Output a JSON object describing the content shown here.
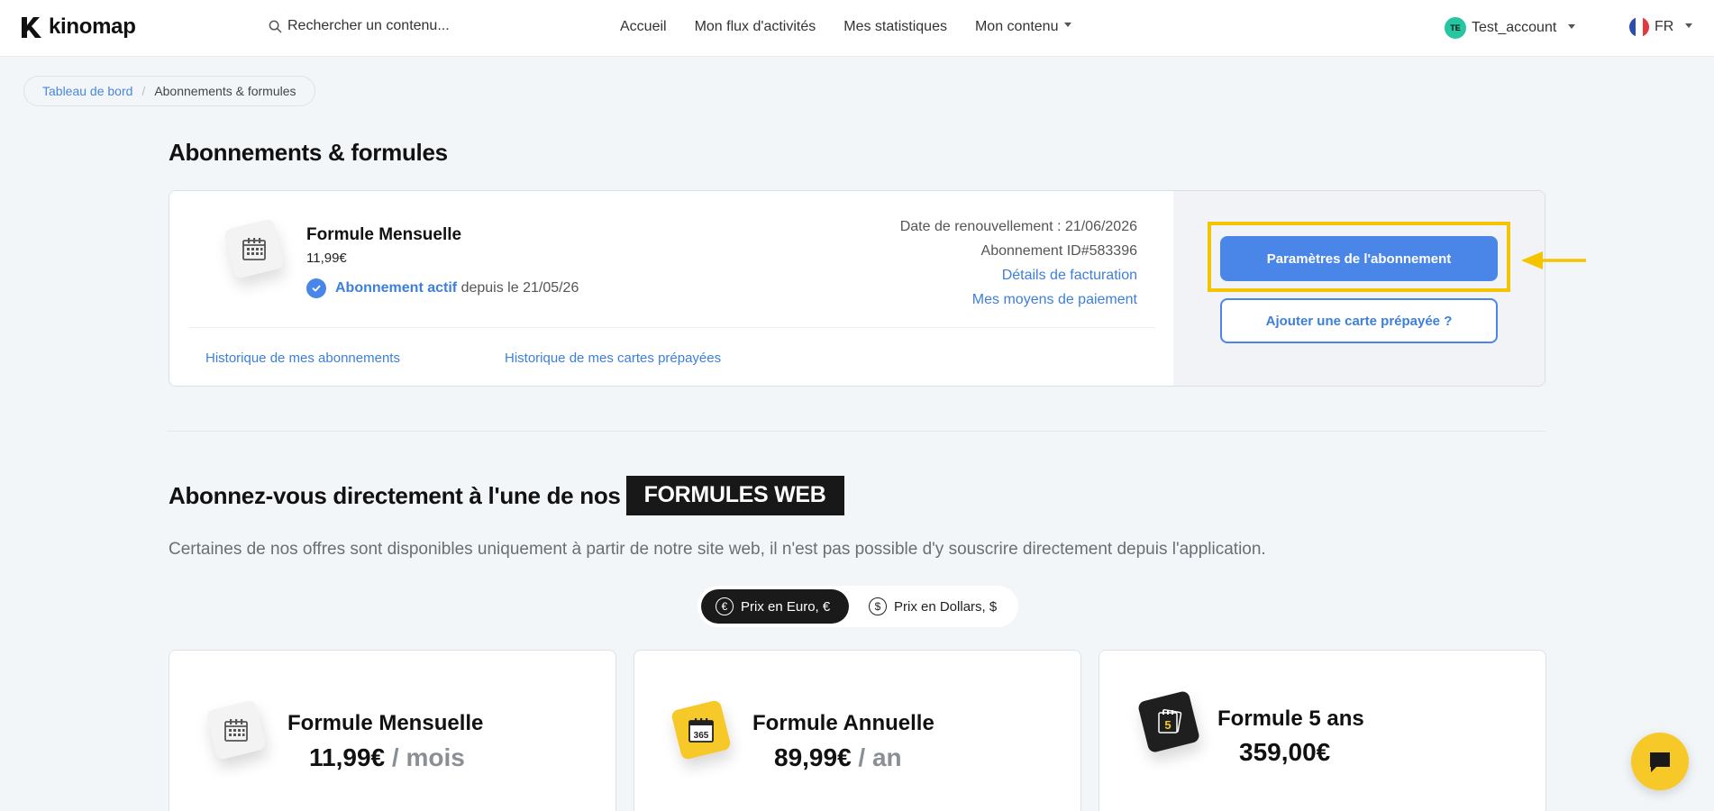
{
  "brand": {
    "name": "kinomap"
  },
  "search": {
    "placeholder": "Rechercher un contenu..."
  },
  "nav": {
    "home": "Accueil",
    "feed": "Mon flux d'activités",
    "stats": "Mes statistiques",
    "content": "Mon contenu"
  },
  "user": {
    "initials": "TE",
    "name": "Test_account"
  },
  "lang": {
    "code": "FR"
  },
  "breadcrumb": {
    "root": "Tableau de bord",
    "separator": "/",
    "current": "Abonnements & formules"
  },
  "page": {
    "title": "Abonnements & formules"
  },
  "subscription": {
    "plan_name": "Formule Mensuelle",
    "price": "11,99€",
    "status_label": "Abonnement actif",
    "status_since": "depuis le 21/05/26",
    "renewal": "Date de renouvellement : 21/06/2026",
    "id": "Abonnement ID#583396",
    "billing_link": "Détails de facturation",
    "payment_link": "Mes moyens de paiement",
    "history_subscriptions": "Historique de mes abonnements",
    "history_cards": "Historique de mes cartes prépayées",
    "settings_button": "Paramètres de l'abonnement",
    "prepaid_button": "Ajouter une carte prépayée ?"
  },
  "offers": {
    "title": "Abonnez-vous directement à l'une de nos",
    "badge": "FORMULES WEB",
    "description": "Certaines de nos offres sont disponibles uniquement à partir de notre site web, il n'est pas possible d'y souscrire directement depuis l'application.",
    "currency_euro": "Prix en Euro, €",
    "currency_dollar": "Prix en Dollars, $",
    "plans": [
      {
        "name": "Formule Mensuelle",
        "price": "11,99€",
        "period": "/ mois"
      },
      {
        "name": "Formule Annuelle",
        "price": "89,99€",
        "period": "/ an",
        "icon_text": "365"
      },
      {
        "name": "Formule 5 ans",
        "price": "359,00€",
        "icon_text": "5"
      }
    ]
  },
  "colors": {
    "accent": "#4a86e8",
    "highlight": "#f5c400",
    "dark": "#181818",
    "chat": "#f7c928"
  }
}
